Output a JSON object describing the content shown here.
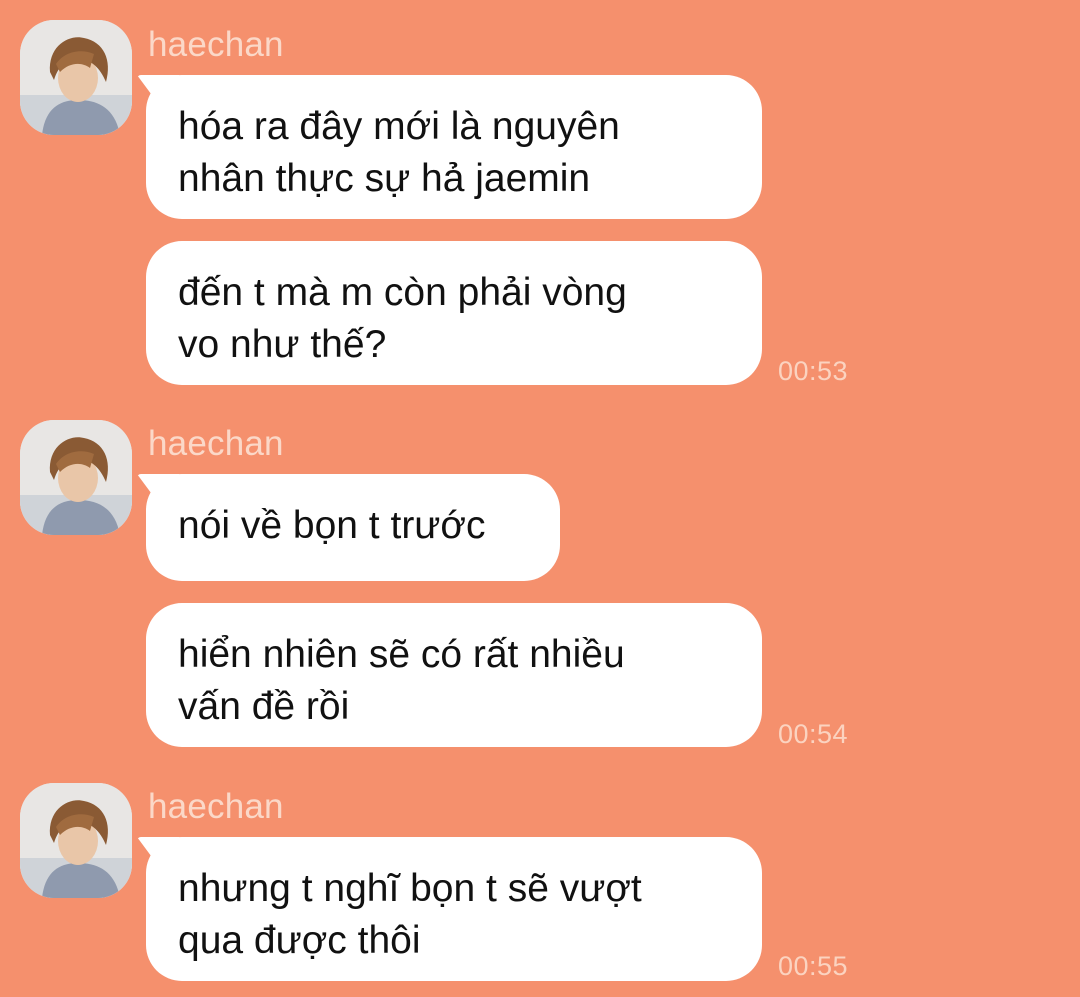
{
  "messages": {
    "group1": {
      "sender": "haechan",
      "bubbles": [
        "hóa ra đây mới là nguyên\nnhân thực sự hả jaemin",
        "đến t mà m còn phải vòng\nvo như thế?"
      ],
      "time": "00:53"
    },
    "group2": {
      "sender": "haechan",
      "bubbles": [
        "nói về bọn t trước",
        "hiển nhiên sẽ có rất nhiều\nvấn đề rồi"
      ],
      "time": "00:54"
    },
    "group3": {
      "sender": "haechan",
      "bubbles": [
        "nhưng t nghĩ bọn t sẽ vượt\nqua được thôi"
      ],
      "time": "00:55"
    }
  },
  "colors": {
    "background": "#f5906d",
    "bubble": "#ffffff",
    "sender_name": "#fbd8c8",
    "timestamp": "#fbd3c0"
  },
  "icons": {
    "avatar": "profile-photo"
  }
}
